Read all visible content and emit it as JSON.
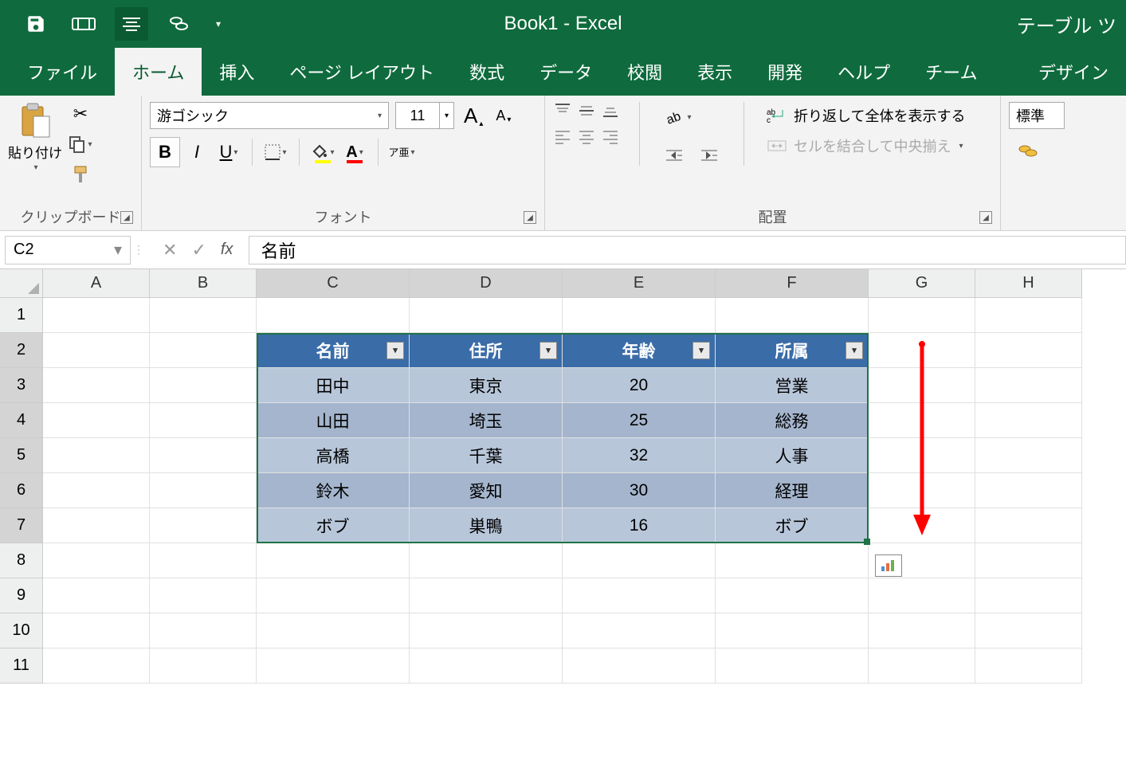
{
  "app": {
    "title": "Book1  -  Excel",
    "context_tab": "テーブル ツ"
  },
  "qat": {
    "save": "save",
    "touch": "touch",
    "center": "center",
    "currency": "currency"
  },
  "tabs": [
    "ファイル",
    "ホーム",
    "挿入",
    "ページ レイアウト",
    "数式",
    "データ",
    "校閲",
    "表示",
    "開発",
    "ヘルプ",
    "チーム",
    "デザイン"
  ],
  "tabs_active_index": 1,
  "ribbon": {
    "clipboard": {
      "paste": "貼り付け",
      "group_label": "クリップボード"
    },
    "font": {
      "name": "游ゴシック",
      "size": "11",
      "bold": "B",
      "italic": "I",
      "underline": "U",
      "phonetic": "ア亜",
      "group_label": "フォント"
    },
    "alignment": {
      "wrap": "折り返して全体を表示する",
      "merge": "セルを結合して中央揃え",
      "group_label": "配置"
    },
    "number": {
      "format": "標準"
    }
  },
  "formula_bar": {
    "name_box": "C2",
    "formula": "名前"
  },
  "columns": [
    "A",
    "B",
    "C",
    "D",
    "E",
    "F",
    "G",
    "H"
  ],
  "selected_cols": [
    "C",
    "D",
    "E",
    "F"
  ],
  "rows": [
    1,
    2,
    3,
    4,
    5,
    6,
    7,
    8,
    9,
    10,
    11
  ],
  "selected_rows": [
    2,
    3,
    4,
    5,
    6,
    7
  ],
  "table": {
    "headers": [
      "名前",
      "住所",
      "年齢",
      "所属"
    ],
    "rows": [
      [
        "田中",
        "東京",
        "20",
        "営業"
      ],
      [
        "山田",
        "埼玉",
        "25",
        "総務"
      ],
      [
        "高橋",
        "千葉",
        "32",
        "人事"
      ],
      [
        "鈴木",
        "愛知",
        "30",
        "経理"
      ],
      [
        "ボブ",
        "巣鴨",
        "16",
        "ボブ"
      ]
    ]
  },
  "chart_data": {
    "type": "table",
    "columns": [
      "名前",
      "住所",
      "年齢",
      "所属"
    ],
    "rows": [
      {
        "名前": "田中",
        "住所": "東京",
        "年齢": 20,
        "所属": "営業"
      },
      {
        "名前": "山田",
        "住所": "埼玉",
        "年齢": 25,
        "所属": "総務"
      },
      {
        "名前": "高橋",
        "住所": "千葉",
        "年齢": 32,
        "所属": "人事"
      },
      {
        "名前": "鈴木",
        "住所": "愛知",
        "年齢": 30,
        "所属": "経理"
      },
      {
        "名前": "ボブ",
        "住所": "巣鴨",
        "年齢": 16,
        "所属": "ボブ"
      }
    ]
  }
}
